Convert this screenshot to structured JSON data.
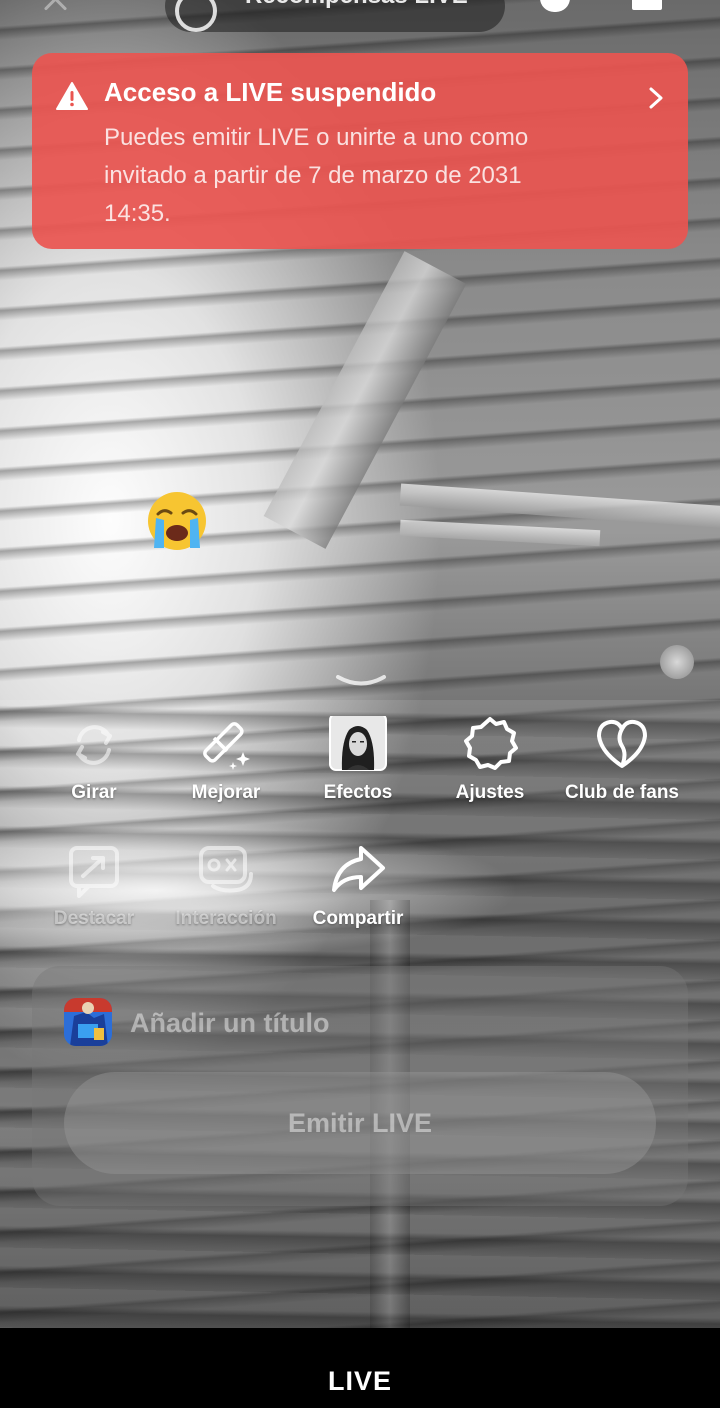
{
  "header": {
    "pill_text": "Recompensas LIVE"
  },
  "banner": {
    "title": "Acceso a LIVE suspendido",
    "body": "Puedes emitir LIVE o unirte a uno como invitado a partir de 7 de marzo de 2031 14:35.",
    "icon": "warning-triangle-icon",
    "color": "#ea5550"
  },
  "overlay": {
    "emoji": "😭"
  },
  "tools": {
    "girar": "Girar",
    "mejorar": "Mejorar",
    "efectos": "Efectos",
    "ajustes": "Ajustes",
    "club_fans": "Club de fans",
    "resaltar": "Destacar",
    "interaccion": "Interacción",
    "compartir": "Compartir"
  },
  "card": {
    "title_placeholder": "Añadir un título",
    "go_live_label": "Emitir LIVE"
  },
  "bottom_bar": {
    "tab_live": "LIVE"
  }
}
